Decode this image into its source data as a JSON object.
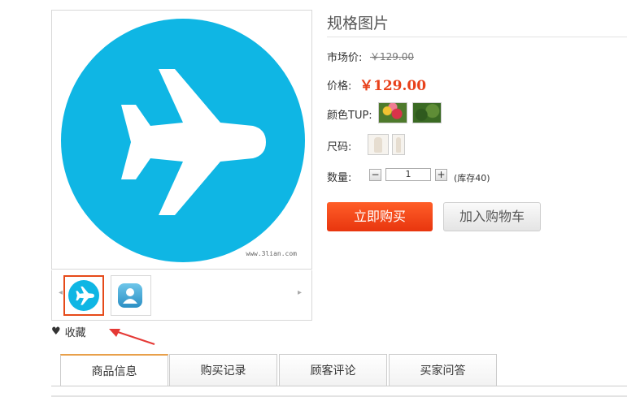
{
  "product": {
    "title": "规格图片",
    "market_price_label": "市场价:",
    "market_price": "￥129.00",
    "price_label": "价格:",
    "price": "￥129.00",
    "color_label": "颜色TUP:",
    "size_label": "尺码:",
    "quantity_label": "数量:",
    "quantity_value": "1",
    "quantity_minus": "−",
    "quantity_plus": "+",
    "stock": "(库存40)"
  },
  "gallery": {
    "watermark": "www.3lian.com",
    "thumb_prev": "◂",
    "thumb_next": "▸"
  },
  "actions": {
    "buy_now": "立即购买",
    "add_to_cart": "加入购物车",
    "favorite": "收藏"
  },
  "tabs": [
    {
      "label": "商品信息",
      "active": true
    },
    {
      "label": "购买记录",
      "active": false
    },
    {
      "label": "顾客评论",
      "active": false
    },
    {
      "label": "买家问答",
      "active": false
    }
  ],
  "icons": {
    "main_image": "airplane-icon",
    "thumb_1": "airplane-icon",
    "thumb_2": "contact-icon",
    "favorite": "heart-icon",
    "annotation": "red-arrow-icon"
  },
  "colors": {
    "accent_price": "#e8411b",
    "image_blue": "#0fb6e4",
    "buy_button": "#ff5e28",
    "selected_thumb_border": "#e64a19",
    "active_tab_border": "#e8a04a"
  }
}
